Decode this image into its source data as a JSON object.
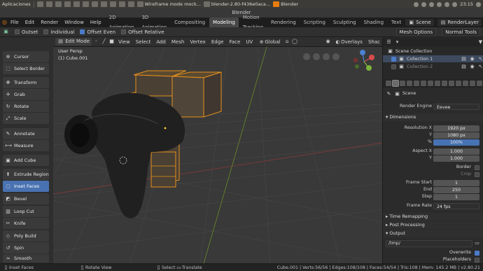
{
  "system_bar": {
    "apps_label": "Aplicaciones",
    "tasks": [
      "Wireframe mode mock...",
      "blender-2.80-f436e0aca...",
      "Blender"
    ],
    "clock": "23:15"
  },
  "window_title": "Blender",
  "menubar": {
    "menus": [
      "File",
      "Edit",
      "Render",
      "Window",
      "Help"
    ],
    "workspaces": [
      "2D Animation",
      "3D Animation",
      "Compositing",
      "Modeling",
      "Motion Tracking",
      "Rendering",
      "Scripting",
      "Sculpting",
      "Shading",
      "Text"
    ],
    "active_workspace": "Modeling",
    "scene": "Scene",
    "view_layer": "RenderLayer"
  },
  "tool_options": {
    "outset": "Outset",
    "individual": "Individual",
    "offset_even": "Offset Even",
    "offset_relative": "Offset Relative",
    "mesh_options": "Mesh Options",
    "normal_tools": "Normal Tools",
    "outset_checked": false,
    "individual_checked": false,
    "offset_even_checked": true,
    "offset_relative_checked": false
  },
  "toolbar": {
    "tools": [
      {
        "label": "Cursor",
        "icon": "cursor-icon"
      },
      {
        "label": "Select Border",
        "icon": "select-border-icon"
      },
      {
        "label": "Transform",
        "icon": "transform-icon"
      },
      {
        "label": "Grab",
        "icon": "grab-icon"
      },
      {
        "label": "Rotate",
        "icon": "rotate-icon"
      },
      {
        "label": "Scale",
        "icon": "scale-icon"
      },
      {
        "label": "Annotate",
        "icon": "annotate-icon"
      },
      {
        "label": "Measure",
        "icon": "measure-icon"
      },
      {
        "label": "Add Cube",
        "icon": "add-cube-icon"
      },
      {
        "label": "Extrude Region",
        "icon": "extrude-icon"
      },
      {
        "label": "Inset Faces",
        "icon": "inset-icon"
      },
      {
        "label": "Bevel",
        "icon": "bevel-icon"
      },
      {
        "label": "Loop Cut",
        "icon": "loop-cut-icon"
      },
      {
        "label": "Knife",
        "icon": "knife-icon"
      },
      {
        "label": "Poly Build",
        "icon": "poly-build-icon"
      },
      {
        "label": "Spin",
        "icon": "spin-icon"
      },
      {
        "label": "Smooth",
        "icon": "smooth-icon"
      }
    ],
    "active_tool": "Inset Faces"
  },
  "viewport_header": {
    "mode": "Edit Mode",
    "menus": [
      "View",
      "Select",
      "Add",
      "Mesh",
      "Vertex",
      "Edge",
      "Face",
      "UV"
    ],
    "orientation": "Global",
    "overlays": "Overlays",
    "shading": "Shac"
  },
  "viewport": {
    "view_name": "User Persp",
    "object_name": "(1) Cube.001"
  },
  "outliner": {
    "root": "Scene Collection",
    "items": [
      "Collection 1",
      "Collection 2"
    ]
  },
  "properties": {
    "scene_label": "Scene",
    "render_engine_label": "Render Engine",
    "render_engine": "Eevee",
    "dimensions_title": "Dimensions",
    "resolution_x_label": "Resolution X",
    "resolution_x": "1920 px",
    "y_label": "Y",
    "resolution_y": "1080 px",
    "percent_label": "%",
    "percent": "100%",
    "aspect_x_label": "Aspect X",
    "aspect_x": "1.000",
    "aspect_y": "1.000",
    "border_label": "Border",
    "crop_label": "Crop",
    "frame_start_label": "Frame Start",
    "frame_start": "1",
    "end_label": "End",
    "frame_end": "250",
    "step_label": "Step",
    "frame_step": "1",
    "frame_rate_label": "Frame Rate",
    "frame_rate": "24 fps",
    "time_remapping": "Time Remapping",
    "post_processing": "Post Processing",
    "output_title": "Output",
    "output_path": "/tmp/",
    "overwrite_label": "Overwrite",
    "placeholders_label": "Placeholders"
  },
  "statusbar": {
    "left": "Inset Faces",
    "mid1": "Rotate View",
    "mid2": "Select",
    "mid3": "Translate",
    "stats": "Cube.001 | Verts:56/56 | Edges:108/108 | Faces:54/54 | Tris:108 | Mem: 145.2 MB | v2.80.21"
  },
  "colors": {
    "accent": "#4772b3",
    "selection_orange": "#e8901c",
    "viewport_bg": "#393939"
  }
}
